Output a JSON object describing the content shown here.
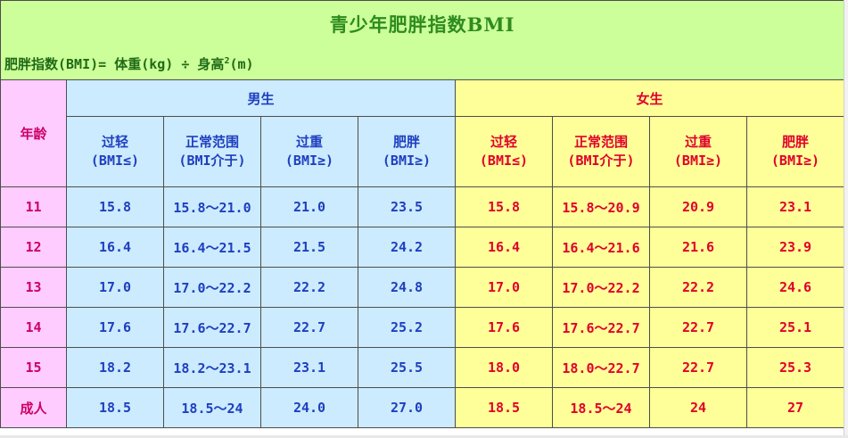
{
  "title": "青少年肥胖指数BMI",
  "formula": {
    "text": "肥胖指数(BMI)= 体重(kg) ÷ 身高",
    "sup": "2",
    "suffix": "(m)"
  },
  "headers": {
    "age": "年龄",
    "boy_group": "男生",
    "girl_group": "女生",
    "boy_cols": [
      {
        "name": "过轻",
        "sub": "(BMI≤)"
      },
      {
        "name": "正常范围",
        "sub": "(BMI介于)"
      },
      {
        "name": "过重",
        "sub": "(BMI≥)"
      },
      {
        "name": "肥胖",
        "sub": "(BMI≥)"
      }
    ],
    "girl_cols": [
      {
        "name": "过轻",
        "sub": "(BMI≤)"
      },
      {
        "name": "正常范围",
        "sub": "(BMI介于)"
      },
      {
        "name": "过重",
        "sub": "(BMI≥)"
      },
      {
        "name": "肥胖",
        "sub": "(BMI≥)"
      }
    ]
  },
  "rows": [
    {
      "age": "11",
      "boy": [
        "15.8",
        "15.8～21.0",
        "21.0",
        "23.5"
      ],
      "girl": [
        "15.8",
        "15.8～20.9",
        "20.9",
        "23.1"
      ]
    },
    {
      "age": "12",
      "boy": [
        "16.4",
        "16.4～21.5",
        "21.5",
        "24.2"
      ],
      "girl": [
        "16.4",
        "16.4～21.6",
        "21.6",
        "23.9"
      ]
    },
    {
      "age": "13",
      "boy": [
        "17.0",
        "17.0～22.2",
        "22.2",
        "24.8"
      ],
      "girl": [
        "17.0",
        "17.0～22.2",
        "22.2",
        "24.6"
      ]
    },
    {
      "age": "14",
      "boy": [
        "17.6",
        "17.6～22.7",
        "22.7",
        "25.2"
      ],
      "girl": [
        "17.6",
        "17.6～22.7",
        "22.7",
        "25.1"
      ]
    },
    {
      "age": "15",
      "boy": [
        "18.2",
        "18.2～23.1",
        "23.1",
        "25.5"
      ],
      "girl": [
        "18.0",
        "18.0～22.7",
        "22.7",
        "25.3"
      ]
    },
    {
      "age": "成人",
      "boy": [
        "18.5",
        "18.5～24",
        "24.0",
        "27.0"
      ],
      "girl": [
        "18.5",
        "18.5～24",
        "24",
        "27"
      ]
    }
  ],
  "colors": {
    "title_bg": "#ccff99",
    "age_bg": "#ffccff",
    "boy_bg": "#ccebff",
    "girl_bg": "#ffff99",
    "boy_text": "#1f3fbf",
    "girl_text": "#e0002a",
    "age_text": "#cc0066"
  }
}
